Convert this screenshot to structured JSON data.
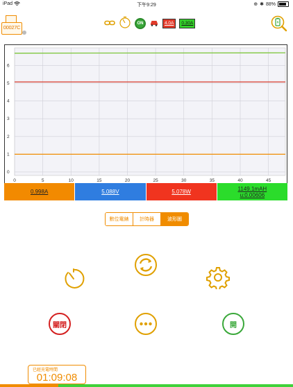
{
  "status": {
    "carrier": "iPad",
    "time": "下午9:29",
    "battery": "88%"
  },
  "device": {
    "id": "00027C"
  },
  "top_bar": {
    "on_label": "ON",
    "current_limit": "4.0A",
    "current_min": "0.30A"
  },
  "chart_data": {
    "type": "line",
    "x_ticks": [
      "0",
      "5",
      "10",
      "15",
      "20",
      "25",
      "30",
      "35",
      "40",
      "45"
    ],
    "y_ticks": [
      "0",
      "1",
      "2",
      "3",
      "4",
      "5",
      "6"
    ],
    "xlim": [
      0,
      48
    ],
    "ylim": [
      -0.2,
      7.0
    ],
    "grid": true,
    "series": [
      {
        "color": "#7cc63a",
        "x": [
          0,
          48
        ],
        "y": [
          6.7,
          6.72
        ]
      },
      {
        "color": "#d83a2a",
        "x": [
          0,
          48
        ],
        "y": [
          5.078,
          5.078
        ]
      },
      {
        "color": "#f08c00",
        "x": [
          0,
          48
        ],
        "y": [
          0.998,
          0.998
        ]
      }
    ]
  },
  "readings": {
    "current": "0.998A",
    "voltage": "5.088V",
    "power": "5.078W",
    "capacity": "1149.1mAH",
    "resistance": "u:0.00606"
  },
  "reading_colors": {
    "current": "#f28a00",
    "voltage": "#2f7de0",
    "power": "#f0341f",
    "capacity": "#2bdc2b"
  },
  "tabs": [
    {
      "label": "數位電錶",
      "active": false
    },
    {
      "label": "計時器",
      "active": false
    },
    {
      "label": "波形圖",
      "active": true
    }
  ],
  "buttons": {
    "off_label": "關閉",
    "on_label": "開"
  },
  "timer": {
    "label": "已經充電時間",
    "value": "01:09:08"
  },
  "progress": 0.2
}
